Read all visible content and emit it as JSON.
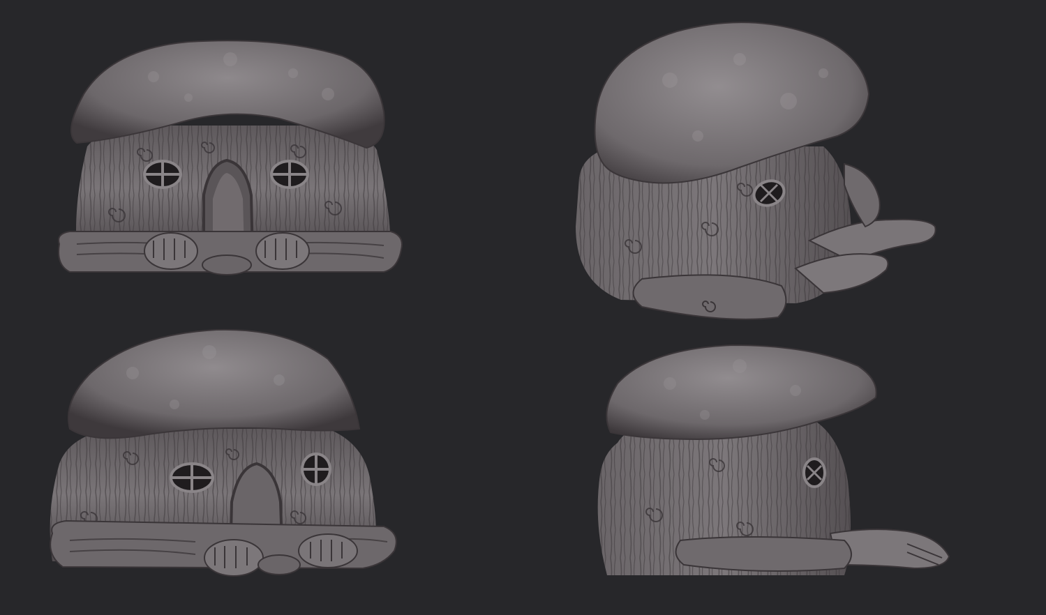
{
  "scene": {
    "background": "#27272a",
    "clay_light": "#8b8689",
    "clay_mid": "#6f6a6d",
    "clay_dark": "#3b3639",
    "views": [
      {
        "id": "front",
        "icon": "mushroom-house-front-view"
      },
      {
        "id": "three-quarter-right",
        "icon": "mushroom-house-three-quarter-view"
      },
      {
        "id": "three-quarter-left",
        "icon": "mushroom-house-three-quarter-left-view"
      },
      {
        "id": "side",
        "icon": "mushroom-house-side-view"
      }
    ]
  }
}
